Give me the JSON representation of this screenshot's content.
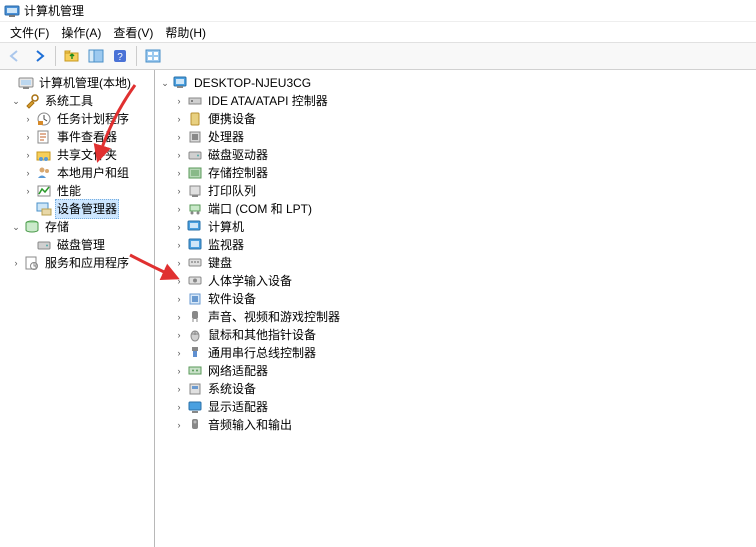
{
  "window": {
    "title": "计算机管理"
  },
  "menu": {
    "file": "文件(F)",
    "action": "操作(A)",
    "view": "查看(V)",
    "help": "帮助(H)"
  },
  "leftTree": {
    "root": "计算机管理(本地)",
    "systemTools": "系统工具",
    "taskScheduler": "任务计划程序",
    "eventViewer": "事件查看器",
    "sharedFolders": "共享文件夹",
    "localUsersGroups": "本地用户和组",
    "performance": "性能",
    "deviceManager": "设备管理器",
    "storage": "存储",
    "diskManagement": "磁盘管理",
    "servicesApps": "服务和应用程序"
  },
  "rightTree": {
    "computerName": "DESKTOP-NJEU3CG",
    "items": [
      "IDE ATA/ATAPI 控制器",
      "便携设备",
      "处理器",
      "磁盘驱动器",
      "存储控制器",
      "打印队列",
      "端口 (COM 和 LPT)",
      "计算机",
      "监视器",
      "键盘",
      "人体学输入设备",
      "软件设备",
      "声音、视频和游戏控制器",
      "鼠标和其他指针设备",
      "通用串行总线控制器",
      "网络适配器",
      "系统设备",
      "显示适配器",
      "音频输入和输出"
    ]
  }
}
